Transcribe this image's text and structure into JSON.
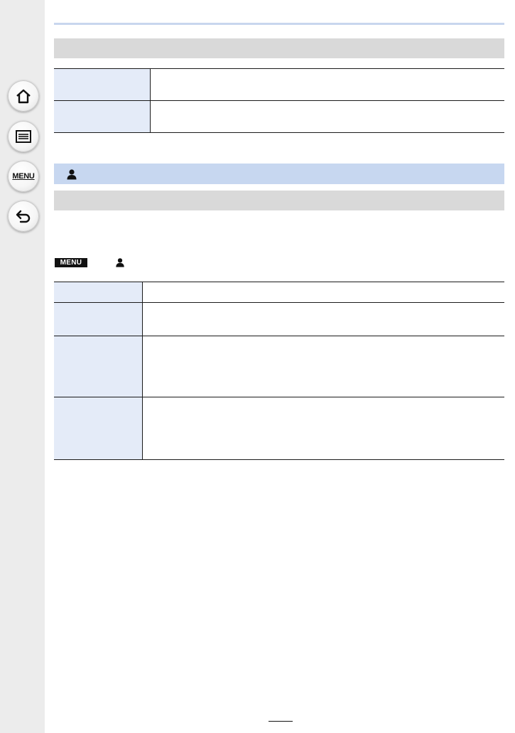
{
  "sidebar": {
    "home": {
      "icon": "home-icon"
    },
    "contents": {
      "icon": "list-icon"
    },
    "menu": {
      "label": "MENU"
    },
    "back": {
      "icon": "back-arrow-icon"
    }
  },
  "sections": {
    "custom_icon": "person-icon"
  },
  "menu_path": {
    "badge": "MENU",
    "arrow": "→",
    "icon": "person-icon"
  },
  "tables": {
    "top_rows": 2,
    "bottom_rows": 4
  },
  "colors": {
    "sidebar_bg": "#ececec",
    "section_bar_gray": "#d9d9d9",
    "section_bar_blue": "#c7d7f0",
    "table_label_bg": "#e4ebf8"
  },
  "page": {
    "number": ""
  }
}
